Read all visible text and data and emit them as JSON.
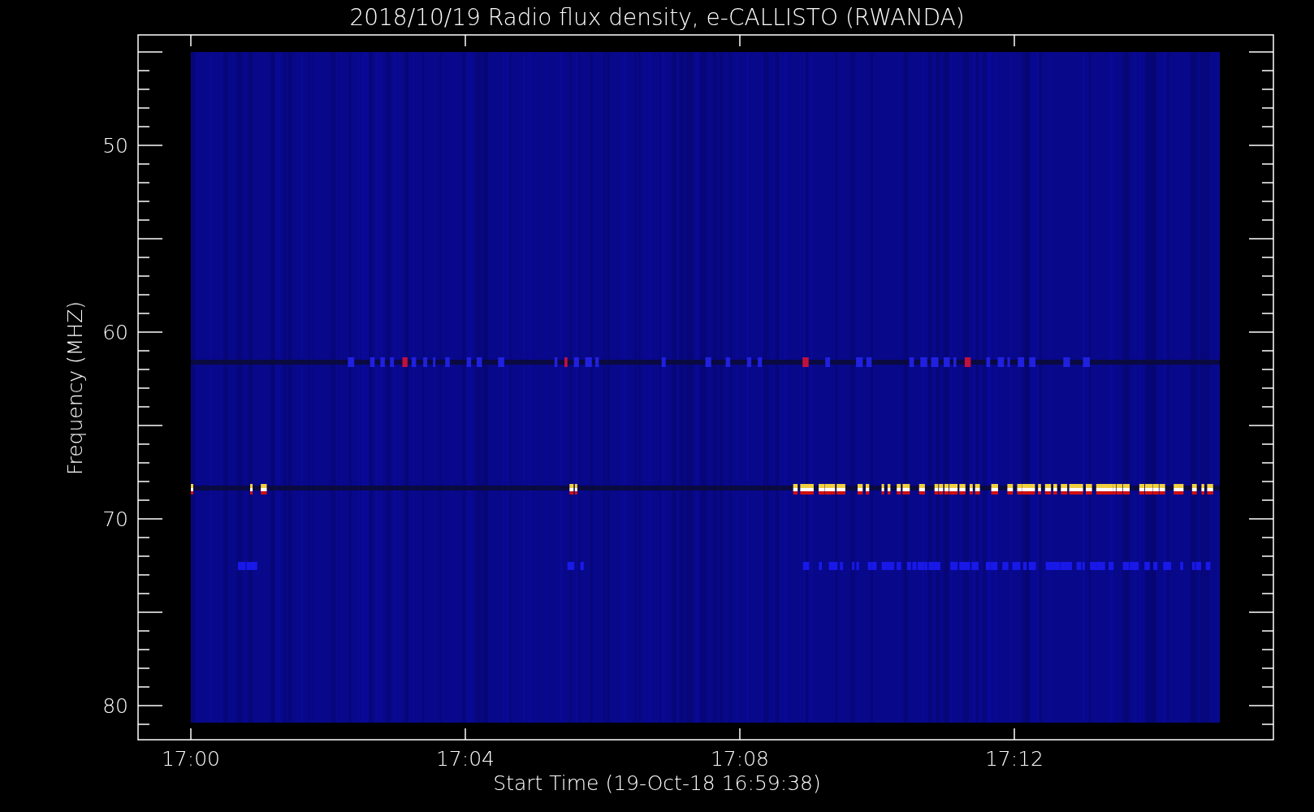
{
  "plot": {
    "title": "2018/10/19  Radio flux density, e-CALLISTO (RWANDA)",
    "y_axis": {
      "label": "Frequency (MHZ)",
      "ticks": [
        "50",
        "60",
        "70",
        "80"
      ]
    },
    "x_axis": {
      "label": "Start Time (19-Oct-18 16:59:38)",
      "ticks": [
        "17:00",
        "17:04",
        "17:08",
        "17:12"
      ]
    }
  }
}
